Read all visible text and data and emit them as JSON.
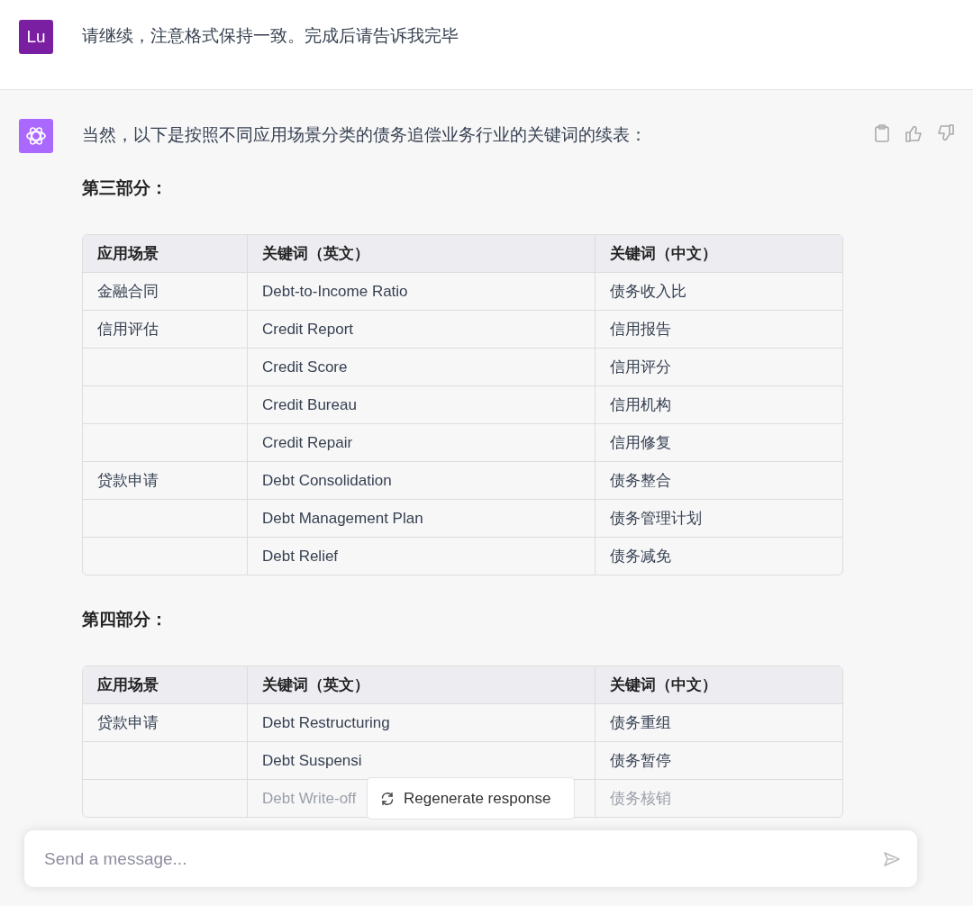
{
  "user_message": {
    "avatar": "Lu",
    "text": "请继续，注意格式保持一致。完成后请告诉我完毕"
  },
  "assistant_message": {
    "intro": "当然，以下是按照不同应用场景分类的债务追偿业务行业的关键词的续表：",
    "sections": [
      {
        "title": "第三部分：",
        "columns": [
          "应用场景",
          "关键词（英文）",
          "关键词（中文）"
        ],
        "rows": [
          {
            "cells": [
              "金融合同",
              "Debt-to-Income Ratio",
              "债务收入比"
            ],
            "faded": false
          },
          {
            "cells": [
              "信用评估",
              "Credit Report",
              "信用报告"
            ],
            "faded": false
          },
          {
            "cells": [
              "",
              "Credit Score",
              "信用评分"
            ],
            "faded": false
          },
          {
            "cells": [
              "",
              "Credit Bureau",
              "信用机构"
            ],
            "faded": false
          },
          {
            "cells": [
              "",
              "Credit Repair",
              "信用修复"
            ],
            "faded": false
          },
          {
            "cells": [
              "贷款申请",
              "Debt Consolidation",
              "债务整合"
            ],
            "faded": false
          },
          {
            "cells": [
              "",
              "Debt Management Plan",
              "债务管理计划"
            ],
            "faded": false
          },
          {
            "cells": [
              "",
              "Debt Relief",
              "债务减免"
            ],
            "faded": false
          }
        ]
      },
      {
        "title": "第四部分：",
        "columns": [
          "应用场景",
          "关键词（英文）",
          "关键词（中文）"
        ],
        "rows": [
          {
            "cells": [
              "贷款申请",
              "Debt Restructuring",
              "债务重组"
            ],
            "faded": false
          },
          {
            "cells": [
              "",
              "Debt Suspensi",
              "债务暂停"
            ],
            "faded": false
          },
          {
            "cells": [
              "",
              "Debt Write-off",
              "债务核销"
            ],
            "faded": true
          }
        ]
      }
    ]
  },
  "regenerate_button": {
    "label": "Regenerate response"
  },
  "composer": {
    "placeholder": "Send a message..."
  }
}
